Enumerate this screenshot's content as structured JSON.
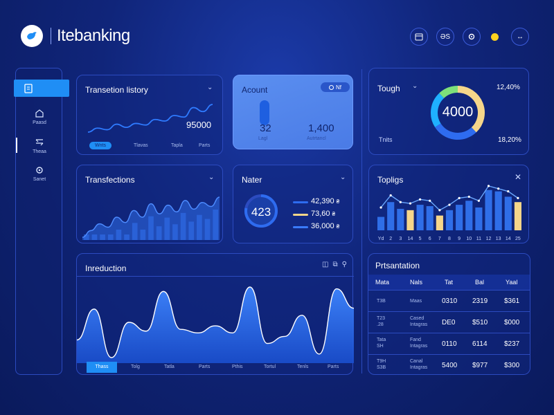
{
  "header": {
    "app_title": "Itebanking",
    "btn1": "",
    "btn2": "ƏS",
    "btn3": "",
    "btn4": "↔"
  },
  "sidebar": {
    "items": [
      {
        "label": "",
        "icon": "wallet-icon"
      },
      {
        "label": "Paasd",
        "icon": "home-icon"
      },
      {
        "label": "Theaa",
        "icon": "transfer-icon"
      },
      {
        "label": "Sanet",
        "icon": "settings-icon"
      }
    ]
  },
  "transaction_history": {
    "title": "Transetion listory",
    "value": "95000",
    "tabs": [
      "Wnts",
      "Tlavas",
      "Tapla",
      "Parts"
    ],
    "chart_data": {
      "type": "line",
      "series": [
        {
          "values": [
            3,
            4,
            3.6,
            5,
            4.2,
            5.2,
            4.8,
            6.2,
            5.8,
            7.2,
            6.8,
            9.2,
            8.2,
            10
          ]
        }
      ]
    }
  },
  "account": {
    "title": "Acount",
    "pill": "Nf",
    "val1": "32",
    "cap1": "Lagl",
    "val2": "1,400",
    "cap2": "Autrtancl"
  },
  "tough": {
    "title": "Tough",
    "pct_top": "12,40%",
    "donut_value": "4000",
    "left_label": "Tnits",
    "pct_bottom": "18,20%",
    "chart_data": {
      "type": "pie",
      "values": [
        38,
        28,
        22,
        12
      ],
      "colors": [
        "#f5d68a",
        "#2e6cf0",
        "#1fb0ff",
        "#7ee07a"
      ]
    }
  },
  "transfections": {
    "title": "Transfections",
    "chart_data": {
      "type": "area",
      "series": [
        {
          "values": [
            2,
            3,
            4,
            3.5,
            5,
            4.2,
            6,
            5,
            7,
            5.5,
            6.8,
            5.8,
            7.5,
            6.2,
            7.2,
            6.6,
            8
          ]
        }
      ]
    }
  },
  "nater": {
    "title": "Nater",
    "gauge_value": "423",
    "legend": [
      {
        "value": "42,390",
        "unit": "₴",
        "color": "#2e6cf0"
      },
      {
        "value": "73,60",
        "unit": "₴",
        "color": "#f5d68a"
      },
      {
        "value": "36,000",
        "unit": "₴",
        "color": "#3a7bff"
      }
    ],
    "gauge_fraction": 0.78
  },
  "toplings": {
    "title": "Topligs",
    "x_labels": [
      "Yd",
      "2",
      "3",
      "14",
      "5",
      "6",
      "7",
      "8",
      "9",
      "10",
      "11",
      "12",
      "13",
      "14",
      "25"
    ],
    "chart_data": {
      "type": "bar",
      "categories": [
        "Yd",
        "2",
        "3",
        "14",
        "5",
        "6",
        "7",
        "8",
        "9",
        "10",
        "11",
        "12",
        "13",
        "14",
        "25"
      ],
      "series": [
        {
          "values": [
            20,
            42,
            32,
            30,
            38,
            36,
            22,
            30,
            38,
            44,
            34,
            60,
            58,
            50,
            42
          ]
        },
        {
          "values": [
            0,
            40,
            0,
            0,
            0,
            0,
            0,
            0,
            40,
            0,
            0,
            0,
            0,
            0,
            0
          ]
        }
      ],
      "line": [
        34,
        52,
        42,
        40,
        46,
        44,
        30,
        38,
        48,
        50,
        44,
        66,
        62,
        58,
        48
      ]
    }
  },
  "introduction": {
    "title": "Inreduction",
    "tabs": [
      "Thass",
      "Tolg",
      "Tatla",
      "Parts",
      "Pthis",
      "Tortul",
      "Tenls",
      "Parts"
    ],
    "chart_data": {
      "type": "area",
      "series": [
        {
          "values": [
            4,
            7.5,
            2,
            6,
            5,
            9.5,
            5.2,
            4.8,
            5.6,
            4.8,
            10,
            3.6,
            4.4,
            6.8,
            2.4,
            9.8,
            7.6
          ]
        }
      ]
    }
  },
  "presentation": {
    "title": "Prtsantation",
    "columns": [
      "Mata",
      "Nals",
      "Tat",
      "Bal",
      "Yaal"
    ],
    "rows": [
      {
        "c1": "T3B",
        "c2": "Maas",
        "c3": "0310",
        "c4": "2319",
        "c5": "$361"
      },
      {
        "c1": "T23\n.28",
        "c2": "Cased\nIntagras",
        "c3": "DE0",
        "c4": "$510",
        "c5": "$000"
      },
      {
        "c1": "Tata\nSH",
        "c2": "Fand\nIntagras",
        "c3": "0110",
        "c4": "6114",
        "c5": "$237"
      },
      {
        "c1": "T9H\nS3B",
        "c2": "Canal\nIntagras",
        "c3": "5400",
        "c4": "$977",
        "c5": "$300"
      }
    ]
  }
}
